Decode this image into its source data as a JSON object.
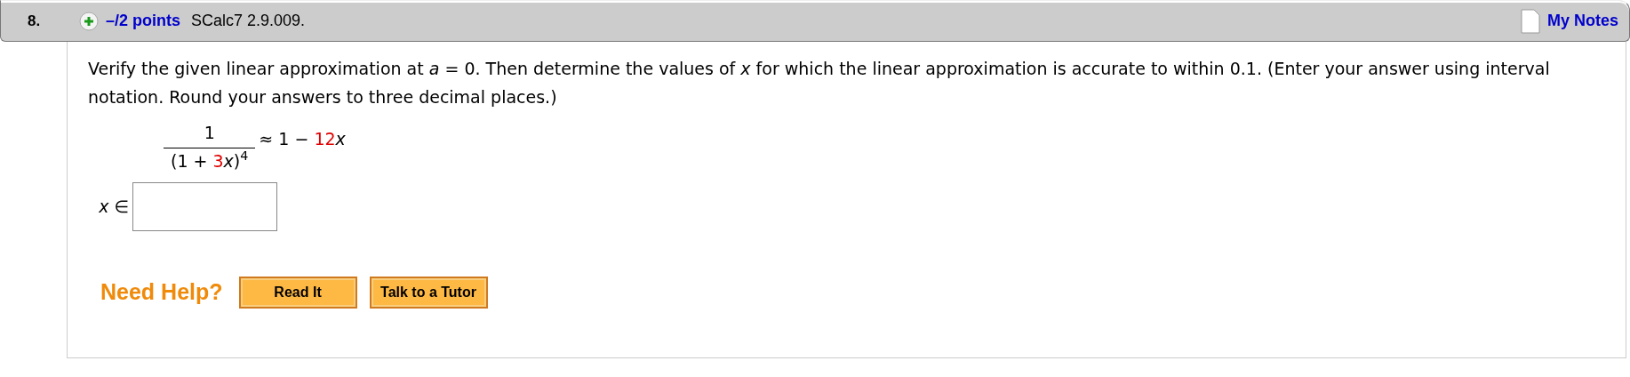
{
  "question": {
    "number": "8.",
    "points": "–/2 points",
    "code": "SCalc7 2.9.009.",
    "notes": "My Notes"
  },
  "prompt": "Verify the given linear approximation at *a* = 0. Then determine the values of *x* for which the linear approximation is accurate to within 0.1. (Enter your answer using interval notation. Round your answers to three decimal places.)",
  "formula": {
    "numerator": [
      {
        "text": "1",
        "color": "#000000"
      }
    ],
    "denominator": [
      {
        "text": "(1 + ",
        "color": "#000000"
      },
      {
        "text": "3",
        "color": "#e00000"
      },
      {
        "text": "*x*)$^{4}$",
        "color": "#000000"
      }
    ],
    "rhs": [
      {
        "text": "≈ 1 − ",
        "color": "#000000"
      },
      {
        "text": "12",
        "color": "#e00000"
      },
      {
        "text": "*x*",
        "color": "#000000"
      }
    ]
  },
  "answer": {
    "label": "*x* ∈"
  },
  "help": {
    "label": "Need Help?",
    "buttons": [
      "Read It",
      "Talk to a Tutor"
    ]
  }
}
